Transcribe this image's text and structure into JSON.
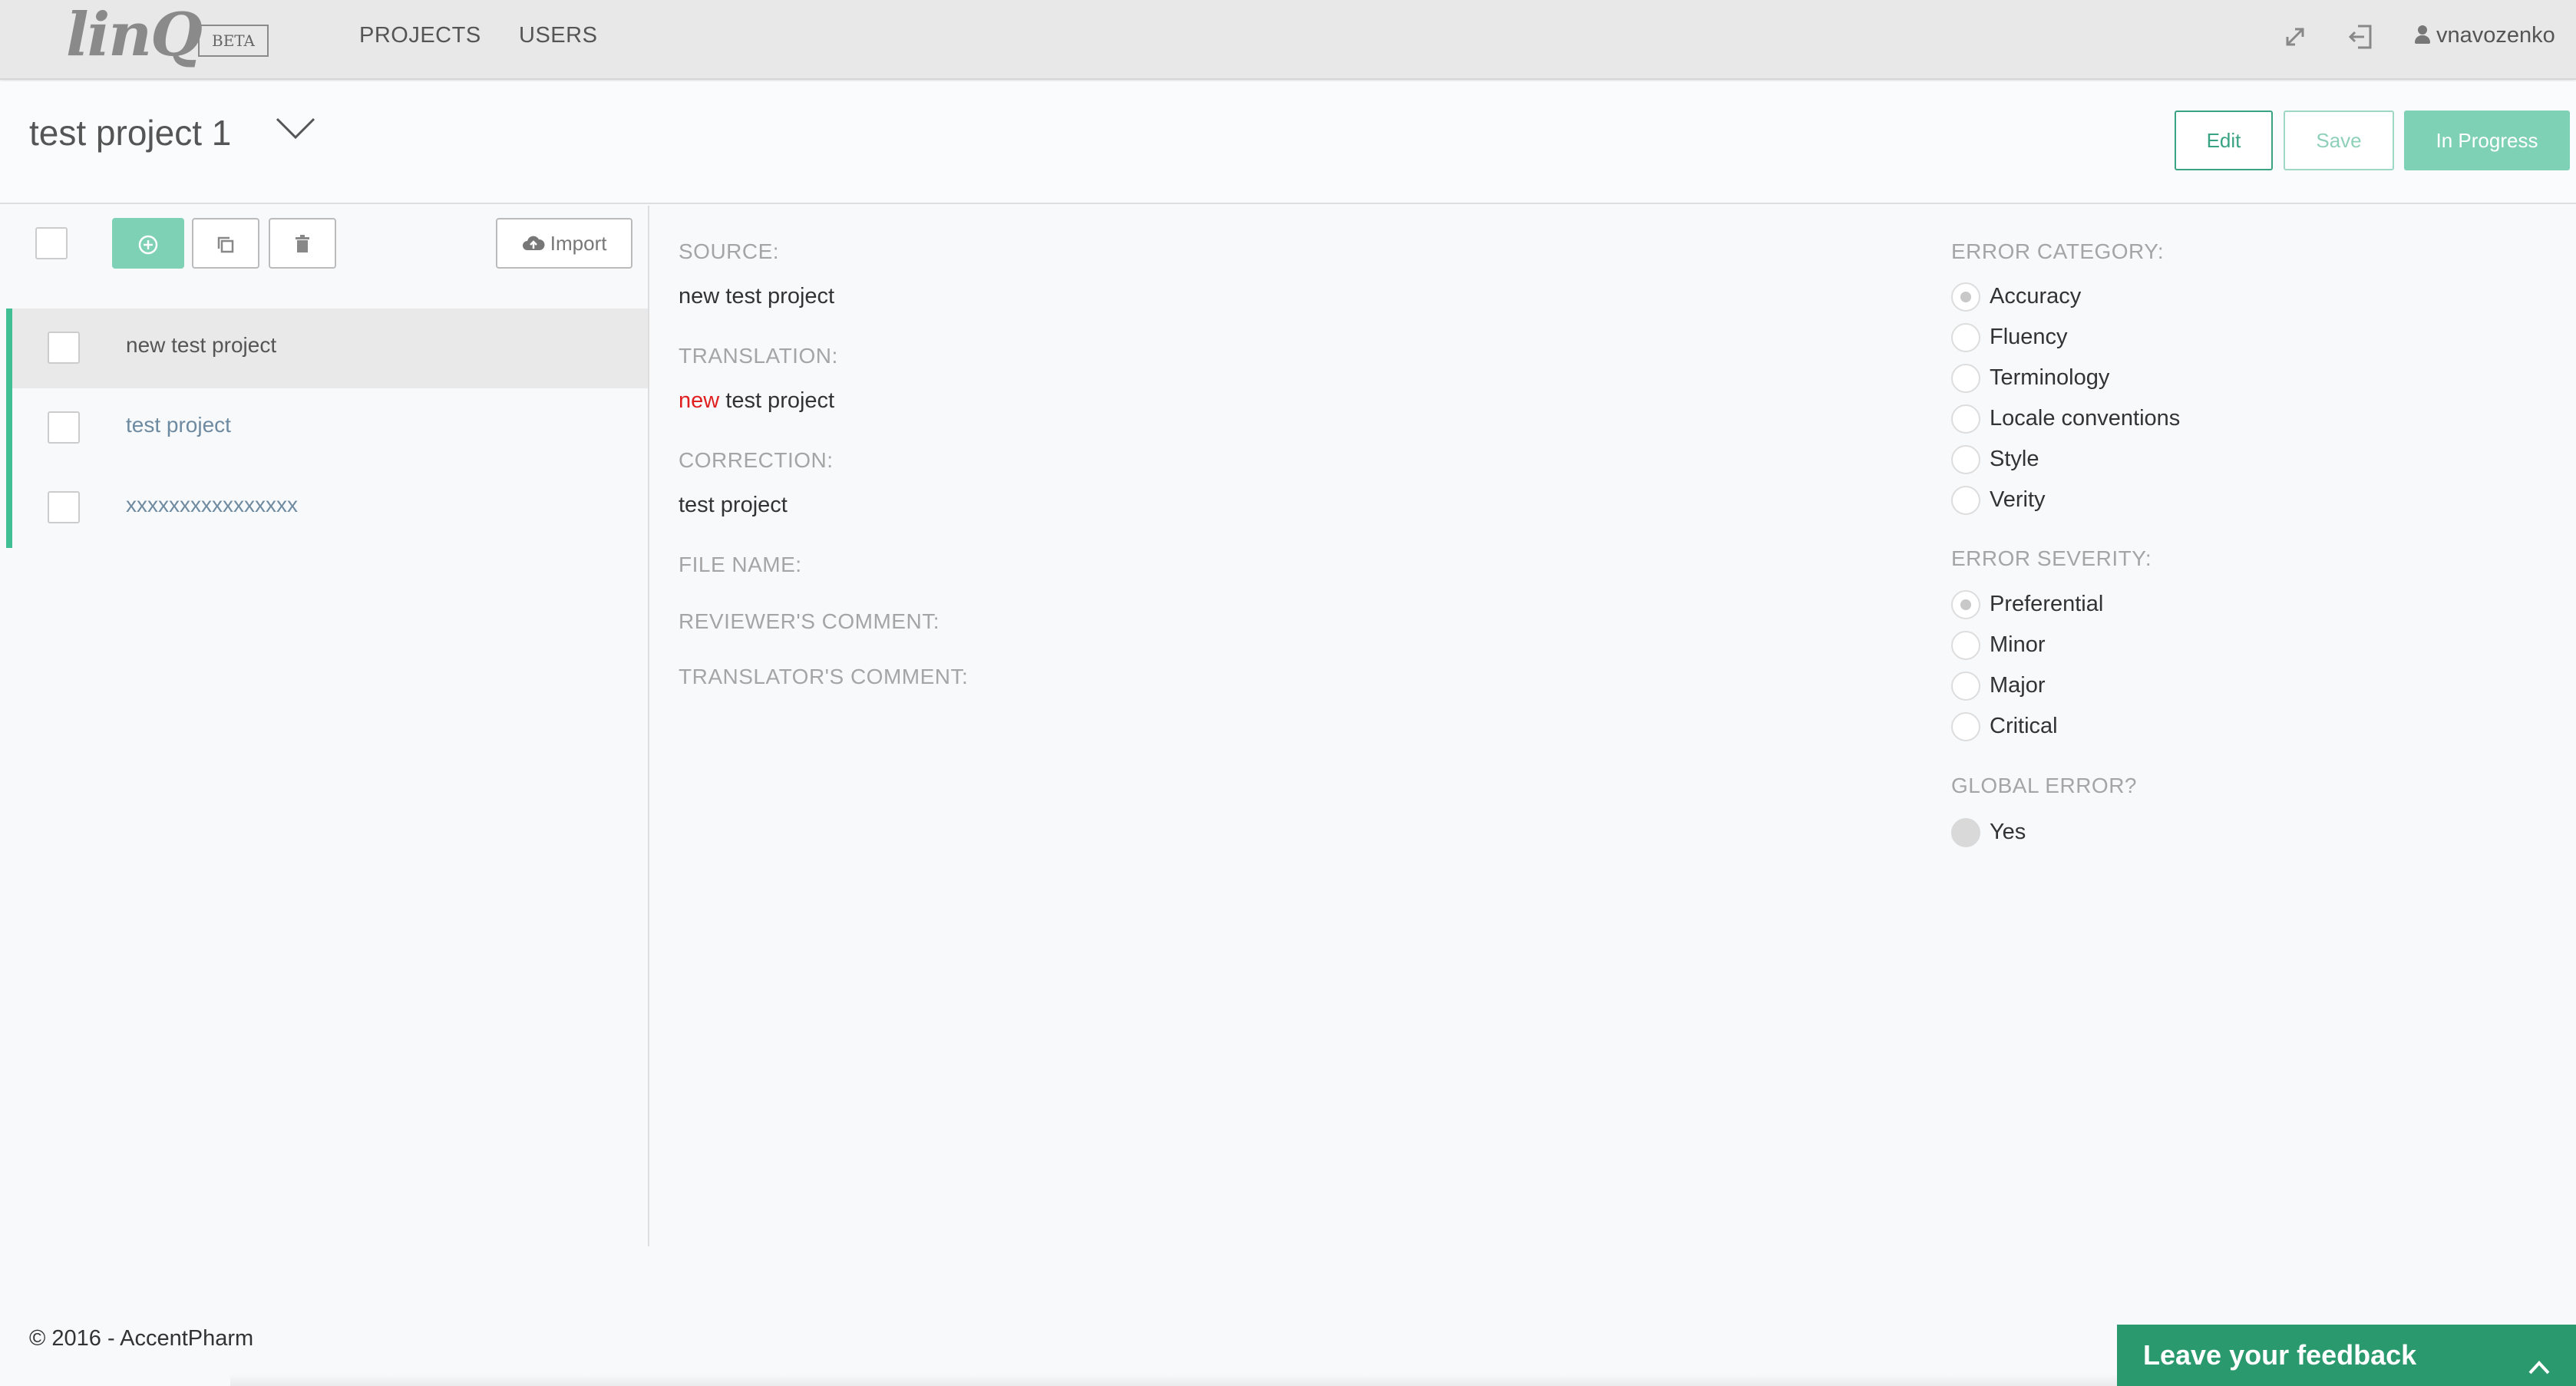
{
  "nav": {
    "logo_text": "lin",
    "logo_q": "Q",
    "beta": "BETA",
    "items": [
      "PROJECTS",
      "USERS"
    ],
    "user": "vnavozenko",
    "icons": [
      "expand-icon",
      "logout-icon",
      "user-icon"
    ]
  },
  "header": {
    "project_title": "test project 1",
    "edit": "Edit",
    "save": "Save",
    "status": "In Progress"
  },
  "toolbar": {
    "import": "Import",
    "icons": [
      "add-icon",
      "copy-icon",
      "delete-icon",
      "cloud-upload-icon"
    ]
  },
  "list": [
    {
      "label": "new test project",
      "selected": true
    },
    {
      "label": "test project",
      "selected": false
    },
    {
      "label": "xxxxxxxxxxxxxxxx",
      "selected": false
    }
  ],
  "detail": {
    "source_label": "SOURCE:",
    "source": "new test project",
    "translation_label": "TRANSLATION:",
    "translation_highlight": "new",
    "translation_rest": " test project",
    "correction_label": "CORRECTION:",
    "correction": "test project",
    "file_name_label": "FILE NAME:",
    "reviewer_comment_label": "REVIEWER'S COMMENT:",
    "translator_comment_label": "TRANSLATOR'S COMMENT:"
  },
  "error_category": {
    "label": "ERROR CATEGORY:",
    "options": [
      "Accuracy",
      "Fluency",
      "Terminology",
      "Locale conventions",
      "Style",
      "Verity"
    ],
    "selected": "Accuracy"
  },
  "error_severity": {
    "label": "ERROR SEVERITY:",
    "options": [
      "Preferential",
      "Minor",
      "Major",
      "Critical"
    ],
    "selected": "Preferential"
  },
  "global_error": {
    "label": "GLOBAL ERROR?",
    "option": "Yes"
  },
  "footer": {
    "copyright": "© 2016 - AccentPharm",
    "feedback": "Leave your feedback"
  },
  "colors": {
    "accent": "#7fd1b6",
    "accent_dark": "#2a9a6e",
    "highlight_red": "#e02020"
  }
}
